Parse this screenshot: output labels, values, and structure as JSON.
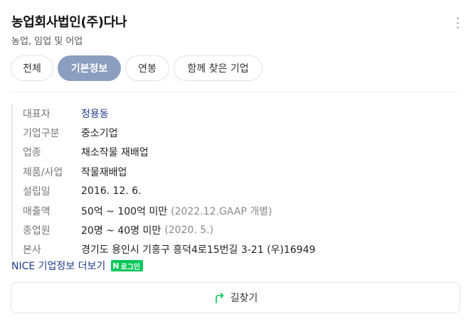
{
  "company": {
    "name": "농업회사법인(주)다나",
    "category": "농업, 임업 및 어업"
  },
  "tabs": [
    {
      "label": "전체",
      "active": false
    },
    {
      "label": "기본정보",
      "active": true
    },
    {
      "label": "연봉",
      "active": false
    },
    {
      "label": "함께 찾은 기업",
      "active": false
    }
  ],
  "info": {
    "ceo": {
      "label": "대표자",
      "value": "정용동"
    },
    "type": {
      "label": "기업구분",
      "value": "중소기업"
    },
    "industry": {
      "label": "업종",
      "value": "채소작물 재배업"
    },
    "product": {
      "label": "제품/사업",
      "value": "작물재배업"
    },
    "founded": {
      "label": "설립일",
      "value": "2016. 12. 6."
    },
    "revenue": {
      "label": "매출액",
      "value": "50억 ~ 100억 미만",
      "note": "(2022.12.GAAP 개별)"
    },
    "employees": {
      "label": "종업원",
      "value": "20명 ~ 40명 미만",
      "note": "(2020. 5.)"
    },
    "address": {
      "label": "본사",
      "value": "경기도 용인시 기흥구 흥덕4로15번길 3-21 (우)16949"
    }
  },
  "nice": {
    "link_label": "NICE 기업정보 더보기",
    "badge_letter": "N",
    "badge_label": "로그인"
  },
  "route": {
    "label": "길찾기"
  },
  "icons": {
    "more": "more-vertical-icon",
    "route": "route-arrow-icon"
  },
  "colors": {
    "active_tab": "#8b9ec0",
    "link": "#1f3c88",
    "badge": "#03c75a",
    "route_icon": "#03c75a"
  }
}
